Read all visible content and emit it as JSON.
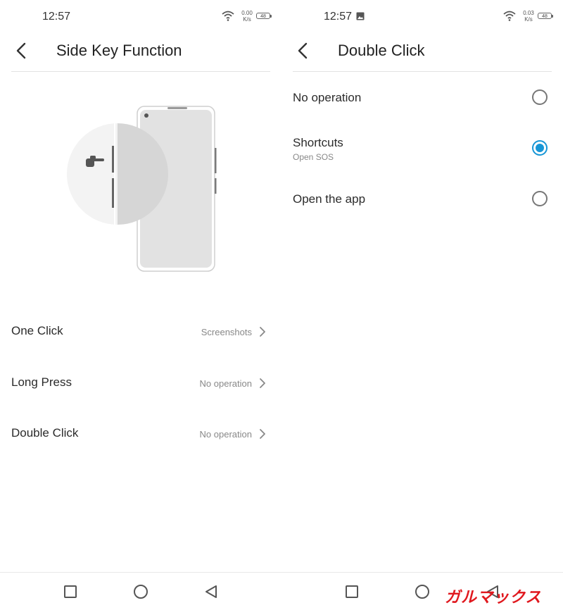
{
  "left": {
    "status": {
      "time": "12:57",
      "speed_value": "0.00",
      "speed_unit": "K/s",
      "battery": "48"
    },
    "header": {
      "title": "Side Key Function"
    },
    "settings": [
      {
        "label": "One Click",
        "value": "Screenshots"
      },
      {
        "label": "Long Press",
        "value": "No operation"
      },
      {
        "label": "Double Click",
        "value": "No operation"
      }
    ]
  },
  "right": {
    "status": {
      "time": "12:57",
      "speed_value": "0.03",
      "speed_unit": "K/s",
      "battery": "48"
    },
    "header": {
      "title": "Double Click"
    },
    "options": [
      {
        "label": "No operation",
        "sub": "",
        "selected": false
      },
      {
        "label": "Shortcuts",
        "sub": "Open SOS",
        "selected": true
      },
      {
        "label": "Open the app",
        "sub": "",
        "selected": false
      }
    ]
  },
  "watermark": "ガルマックス",
  "colors": {
    "accent": "#1796d6",
    "watermark": "#e0181e"
  }
}
